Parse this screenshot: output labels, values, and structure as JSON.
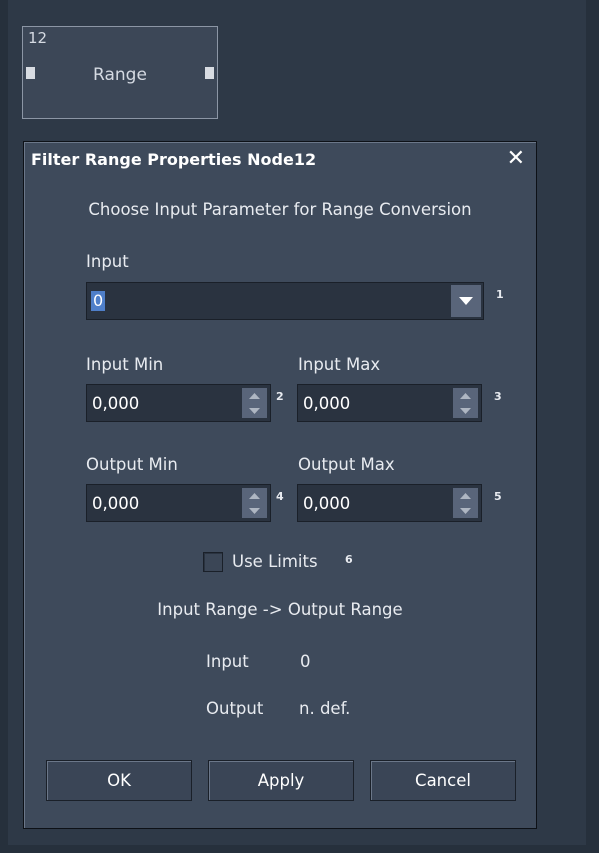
{
  "node": {
    "number": "12",
    "label": "Range"
  },
  "dialog": {
    "title": "Filter Range Properties Node12",
    "heading": "Choose Input Parameter for Range Conversion",
    "input": {
      "label": "Input",
      "value": "0",
      "badge": "1"
    },
    "input_min": {
      "label": "Input Min",
      "value": "0,000",
      "badge": "2"
    },
    "input_max": {
      "label": "Input Max",
      "value": "0,000",
      "badge": "3"
    },
    "output_min": {
      "label": "Output Min",
      "value": "0,000",
      "badge": "4"
    },
    "output_max": {
      "label": "Output Max",
      "value": "0,000",
      "badge": "5"
    },
    "use_limits": {
      "label": "Use Limits",
      "badge": "6",
      "checked": false
    },
    "range_caption": "Input Range -> Output Range",
    "readout": {
      "input_label": "Input",
      "input_value": "0",
      "output_label": "Output",
      "output_value": "n. def."
    },
    "buttons": {
      "ok": "OK",
      "apply": "Apply",
      "cancel": "Cancel"
    }
  },
  "icons": {
    "close": "close-icon",
    "dropdown": "chevron-down-icon",
    "spin_up": "arrow-up-icon",
    "spin_down": "arrow-down-icon"
  }
}
